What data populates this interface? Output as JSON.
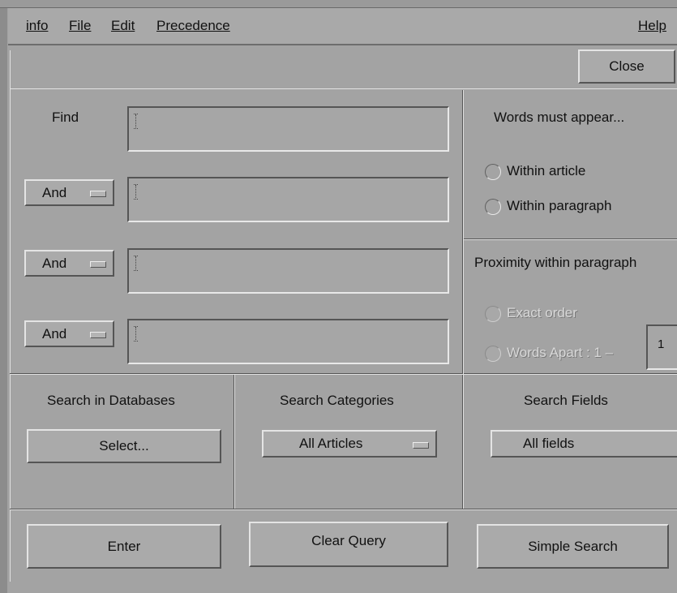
{
  "menubar": {
    "info": "info",
    "file": "File",
    "edit": "Edit",
    "precedence": "Precedence",
    "help": "Help"
  },
  "toolbar": {
    "close_label": "Close"
  },
  "query": {
    "find_label": "Find",
    "operators": [
      "And",
      "And",
      "And"
    ]
  },
  "appear": {
    "title": "Words must appear...",
    "options": [
      "Within article",
      "Within paragraph"
    ]
  },
  "proximity": {
    "title": "Proximity within paragraph",
    "exact_order": "Exact order",
    "words_apart": "Words Apart : 1 –",
    "words_apart_value": "1"
  },
  "databases": {
    "title": "Search in Databases",
    "select_label": "Select..."
  },
  "categories": {
    "title": "Search Categories",
    "selected": "All Articles"
  },
  "fields": {
    "title": "Search Fields",
    "selected": "All fields"
  },
  "actions": {
    "enter": "Enter",
    "clear": "Clear Query",
    "simple": "Simple Search"
  }
}
